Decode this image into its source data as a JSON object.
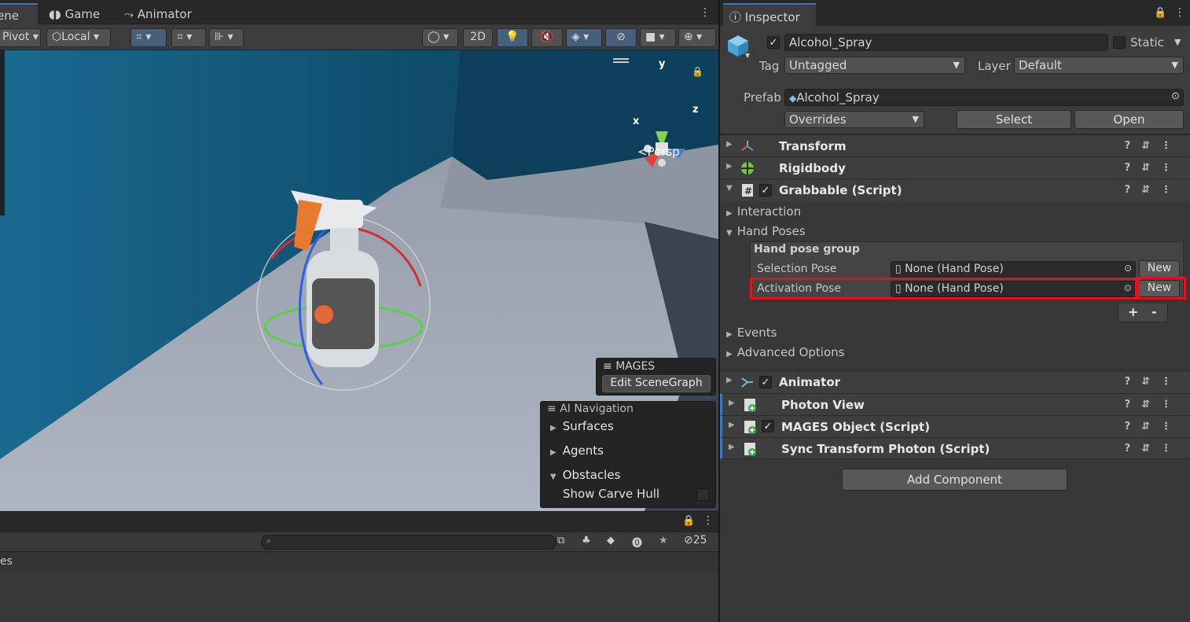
{
  "scene_tabs": {
    "scene": "ene",
    "game": "Game",
    "animator": "Animator"
  },
  "scene_toolbar": {
    "pivot": "Pivot",
    "local": "Local",
    "mode_2d": "2D"
  },
  "viewport": {
    "persp": "Persp",
    "axis_x": "x",
    "axis_y": "y",
    "axis_z": "z",
    "mages_title": "MAGES",
    "mages_button": "Edit SceneGraph",
    "ai_nav_title": "AI Navigation",
    "ai_nav_items": [
      "Surfaces",
      "Agents",
      "Obstacles"
    ],
    "show_carve_hull": "Show Carve Hull"
  },
  "bottom": {
    "count": "25",
    "list_label": "es",
    "search_placeholder": ""
  },
  "inspector": {
    "tab": "Inspector",
    "object_name": "Alcohol_Spray",
    "static_label": "Static",
    "tag_label": "Tag",
    "tag_value": "Untagged",
    "layer_label": "Layer",
    "layer_value": "Default",
    "prefab_label": "Prefab",
    "prefab_value": "Alcohol_Spray",
    "overrides": "Overrides",
    "select": "Select",
    "open": "Open",
    "components": {
      "transform": "Transform",
      "rigidbody": "Rigidbody",
      "grabbable": "Grabbable (Script)",
      "animator": "Animator",
      "photon_view": "Photon View",
      "mages_object": "MAGES Object (Script)",
      "sync_transform": "Sync Transform Photon (Script)"
    },
    "grabbable": {
      "interaction": "Interaction",
      "hand_poses": "Hand Poses",
      "group_title": "Hand pose group",
      "selection_pose_label": "Selection Pose",
      "selection_pose_value": "None (Hand Pose)",
      "activation_pose_label": "Activation Pose",
      "activation_pose_value": "None (Hand Pose)",
      "new": "New",
      "plus": "+",
      "minus": "-",
      "events": "Events",
      "advanced": "Advanced Options"
    },
    "add_component": "Add Component"
  },
  "colors": {
    "accent": "#3a79bb",
    "highlight": "#e0141e"
  }
}
